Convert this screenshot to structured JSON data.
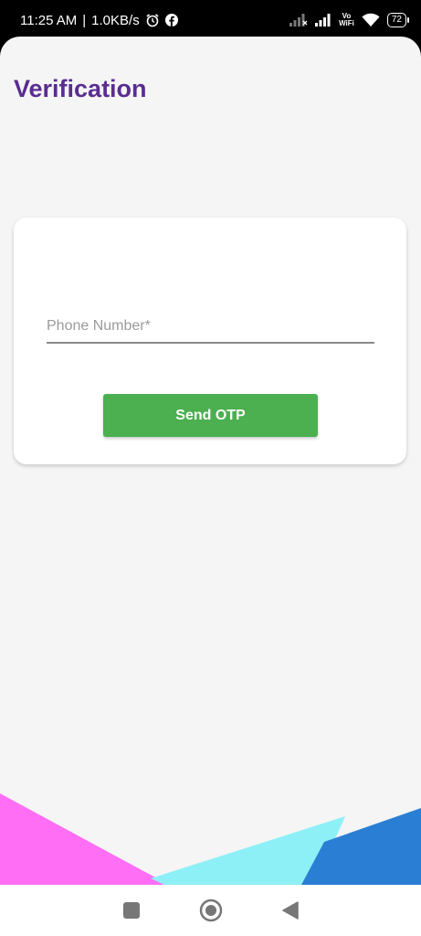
{
  "status_bar": {
    "time": "11:25 AM",
    "separator": "|",
    "speed": "1.0KB/s",
    "vowifi_top": "Vo",
    "vowifi_bottom": "WiFi",
    "battery": "72",
    "icons": [
      "alarm-icon",
      "facebook-icon",
      "signal-off-icon",
      "signal-icon",
      "wifi-icon",
      "battery-icon"
    ]
  },
  "header": {
    "title": "Verification",
    "title_color": "#5a2d91"
  },
  "form": {
    "phone_placeholder": "Phone Number*",
    "phone_value": "",
    "send_button_label": "Send OTP",
    "button_color": "#4caf50"
  },
  "decoration": {
    "colors": [
      "#ff6ef5",
      "#8ef0f7",
      "#2a7fd4"
    ]
  },
  "nav_bar": {
    "icons": [
      "recents-square-icon",
      "home-circle-icon",
      "back-triangle-icon"
    ]
  }
}
